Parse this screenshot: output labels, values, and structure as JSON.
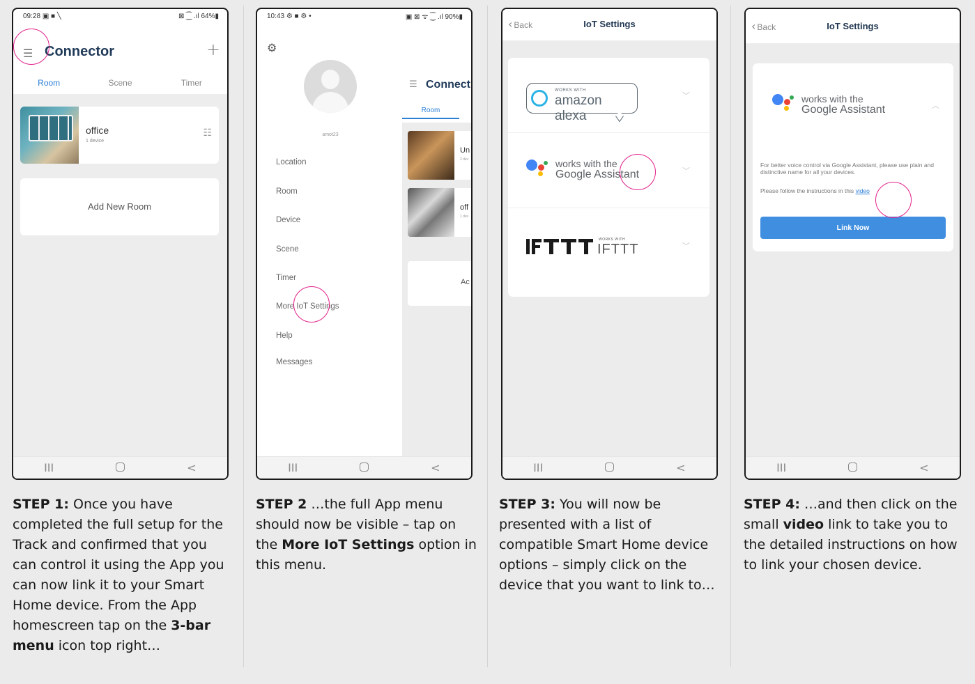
{
  "phone1": {
    "status_time": "09:28",
    "status_icons": "▣ ■ ╲",
    "status_right": "⊠ ⁐ .ıl 64%▮",
    "title": "Connector",
    "tabs": [
      "Room",
      "Scene",
      "Timer"
    ],
    "room_name": "office",
    "room_devices": "1 device",
    "add_room": "Add New Room"
  },
  "phone2": {
    "status_time": "10:43",
    "status_icons": "⚙ ■ ⚙ •",
    "status_right": "▣ ⊠ ᯤ ⁐ .ıl 90%▮",
    "user": "amot23",
    "menu": [
      "Location",
      "Room",
      "Device",
      "Scene",
      "Timer",
      "More IoT Settings",
      "Help",
      "Messages"
    ],
    "bg_title": "Connect",
    "bg_tab": "Room",
    "bg_card1": "Un",
    "bg_card1_sub": "2 dev",
    "bg_card2": "off",
    "bg_card2_sub": "1 dev",
    "bg_add": "Ac"
  },
  "phone3": {
    "back": "Back",
    "title": "IoT Settings",
    "alexa_works": "WORKS WITH",
    "alexa_name": "amazon alexa",
    "ga_line1": "works with the",
    "ga_line2": "Google Assistant",
    "ifttt_works": "WORKS WITH",
    "ifttt_name": "IFTTT"
  },
  "phone4": {
    "back": "Back",
    "title": "IoT Settings",
    "ga_line1": "works with the",
    "ga_line2": "Google Assistant",
    "desc": "For better voice control via Google Assistant, please use plain and distinctive name for all your devices.",
    "follow": "Please follow the instructions in this",
    "video_link": "video",
    "link_now": "Link Now"
  },
  "nav": {
    "recent": "III",
    "back": "<"
  },
  "captions": {
    "step1_label": "STEP 1:",
    "step1_text": " Once you have completed the full setup for the Track and confirmed that you can control it using the App you can now link it to your Smart Home device. From the App homescreen tap on the ",
    "step1_bold": "3-bar menu",
    "step1_tail": " icon top right…",
    "step2_label": "STEP 2",
    "step2_text": " …the full App menu should now be visible – tap on the ",
    "step2_bold": "More IoT Settings",
    "step2_tail": " option in this menu.",
    "step3_label": "STEP 3:",
    "step3_text": " You will now be presented with a list of compatible Smart Home device options – simply click on the device that you want to link to…",
    "step4_label": "STEP 4:",
    "step4_text": " …and then click on the small ",
    "step4_bold": "video",
    "step4_tail": " link to take you to the detailed instructions on how to link your chosen device."
  },
  "colors": {
    "highlight_ring": "#e3218b",
    "accent_blue": "#2e7fd6",
    "button_blue": "#3f8ee0"
  }
}
